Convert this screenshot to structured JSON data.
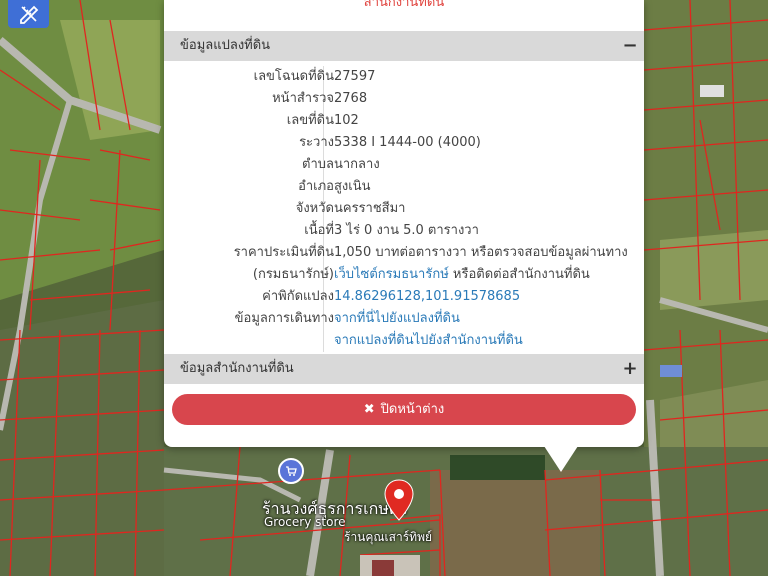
{
  "map": {
    "labels": {
      "shop_name": "ร้านวงศ์ธุรการเกษตร",
      "grocery": "Grocery store",
      "under_pin": "ร้านคุณเสาร์ทิพย์"
    }
  },
  "toolbar": {
    "tool_icon": "pencil-ruler-icon"
  },
  "popup": {
    "top_link": "สำนักงานที่ดิน",
    "section1": {
      "title": "ข้อมูลแปลงที่ดิน",
      "toggle": "−"
    },
    "rows": [
      {
        "key": "เลขโฉนดที่ดิน",
        "value": "27597"
      },
      {
        "key": "หน้าสำรวจ",
        "value": "2768"
      },
      {
        "key": "เลขที่ดิน",
        "value": "102"
      },
      {
        "key": "ระวาง",
        "value": "5338 I 1444-00 (4000)"
      },
      {
        "key": "ตำบล",
        "value": "นากลาง"
      },
      {
        "key": "อำเภอ",
        "value": "สูงเนิน"
      },
      {
        "key": "จังหวัด",
        "value": "นครราชสีมา"
      },
      {
        "key": "เนื้อที่",
        "value": "3 ไร่ 0 งาน 5.0 ตารางวา"
      },
      {
        "key": "ราคาประเมินที่ดิน",
        "value": "1,050 บาทต่อตารางวา หรือตรวจสอบข้อมูลผ่านทาง"
      },
      {
        "key": "(กรมธนารักษ์)",
        "value_link": "เว็บไซต์กรมธนารักษ์",
        "value_tail": " หรือติดต่อสำนักงานที่ดิน"
      },
      {
        "key": "ค่าพิกัดแปลง",
        "value": "14.86296128,101.91578685"
      },
      {
        "key": "ข้อมูลการเดินทาง",
        "value": "จากที่นี่ไปยังแปลงที่ดิน"
      },
      {
        "key": "",
        "value": "จากแปลงที่ดินไปยังสำนักงานที่ดิน"
      }
    ],
    "section2": {
      "title": "ข้อมูลสำนักงานที่ดิน",
      "toggle": "+"
    },
    "close_button": {
      "icon": "close-icon",
      "glyph": "✖",
      "label": "ปิดหน้าต่าง"
    }
  }
}
